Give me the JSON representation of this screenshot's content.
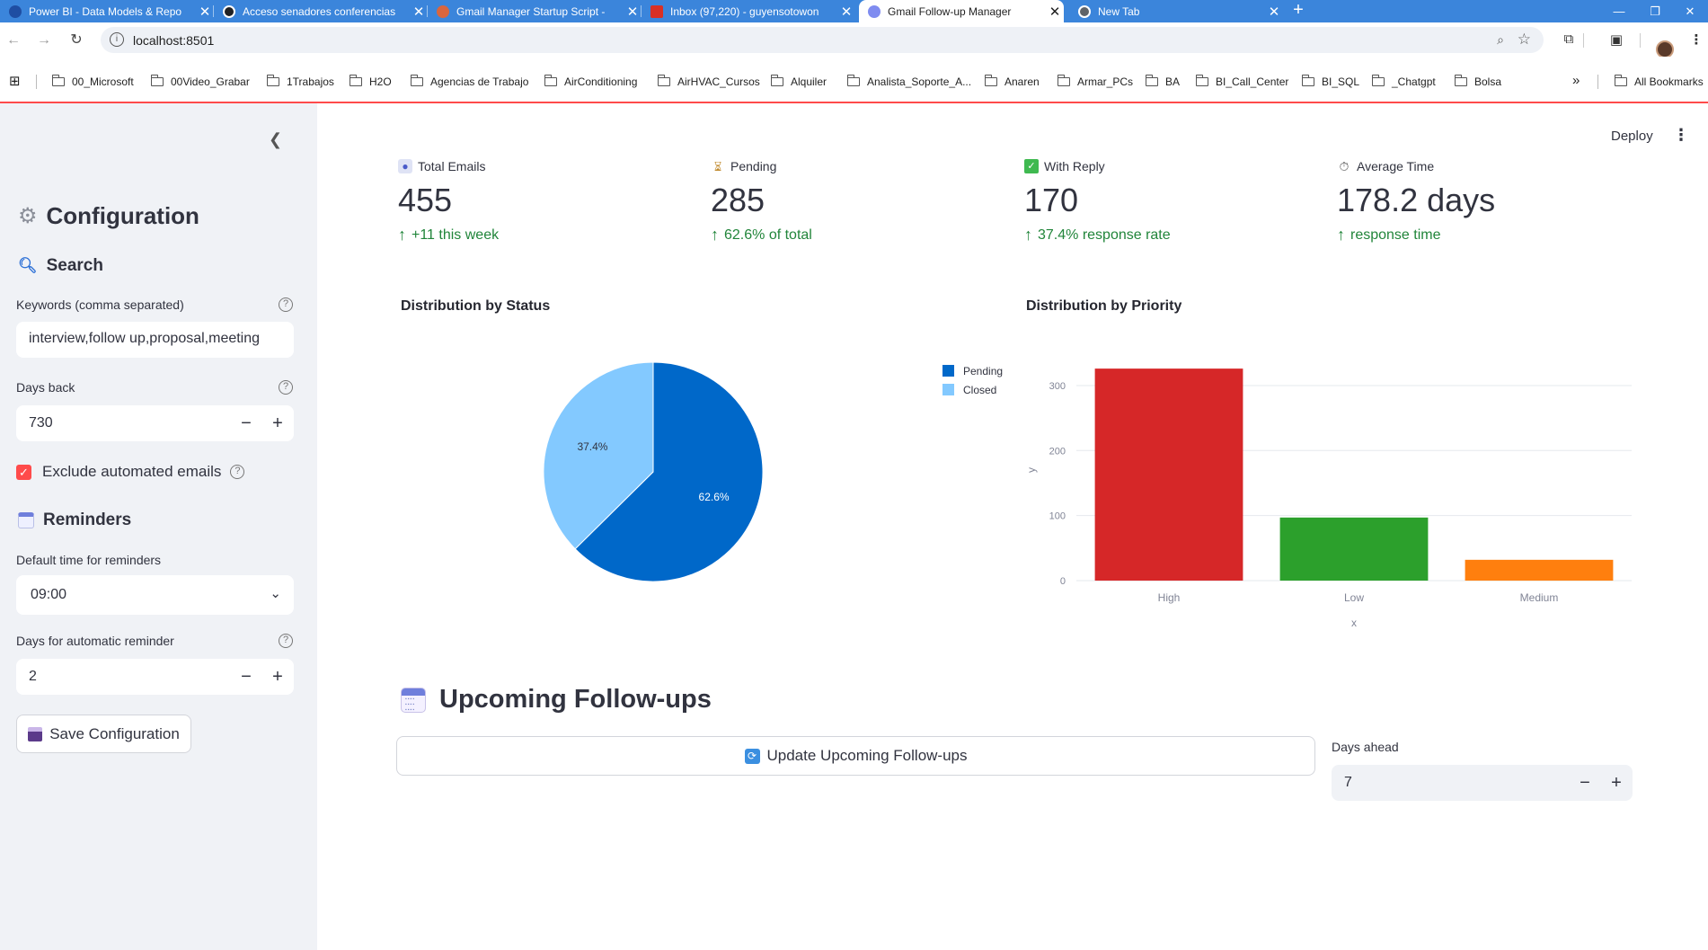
{
  "browser": {
    "tabs": [
      {
        "title": "Power BI - Data Models & Repo",
        "active": false,
        "favicon_color": "#1f4ea3"
      },
      {
        "title": "Acceso senadores conferencias",
        "active": false,
        "favicon_color": "#202124"
      },
      {
        "title": "Gmail Manager Startup Script -",
        "active": false,
        "favicon_color": "#d9663f"
      },
      {
        "title": "Inbox (97,220) - guyensotowon",
        "active": false,
        "favicon_color": "#d93025"
      },
      {
        "title": "Gmail Follow-up Manager",
        "active": true,
        "favicon_color": "#7f8cf0"
      },
      {
        "title": "New Tab",
        "active": false,
        "favicon_color": "#5f6368"
      }
    ],
    "url": "localhost:8501",
    "bookmarks": [
      "00_Microsoft",
      "00Video_Grabar",
      "1Trabajos",
      "H2O",
      "Agencias de Trabajo",
      "AirConditioning",
      "AirHVAC_Cursos",
      "Alquiler",
      "Analista_Soporte_A...",
      "Anaren",
      "Armar_PCs",
      "BA",
      "BI_Call_Center",
      "BI_SQL",
      "_Chatgpt",
      "Bolsa"
    ],
    "all_bookmarks_label": "All Bookmarks"
  },
  "sidebar": {
    "title": "Configuration",
    "search_header": "Search",
    "keywords_label": "Keywords (comma separated)",
    "keywords_value": "interview,follow up,proposal,meeting",
    "days_back_label": "Days back",
    "days_back_value": "730",
    "exclude_label": "Exclude automated emails",
    "exclude_checked": true,
    "reminders_header": "Reminders",
    "default_time_label": "Default time for reminders",
    "default_time_value": "09:00",
    "auto_days_label": "Days for automatic reminder",
    "auto_days_value": "2",
    "save_label": "Save Configuration"
  },
  "header": {
    "deploy_label": "Deploy"
  },
  "metrics": [
    {
      "label": "Total Emails",
      "value": "455",
      "delta": "+11 this week",
      "icon": "email-icon"
    },
    {
      "label": "Pending",
      "value": "285",
      "delta": "62.6% of total",
      "icon": "hourglass-icon"
    },
    {
      "label": "With Reply",
      "value": "170",
      "delta": "37.4% response rate",
      "icon": "check-icon"
    },
    {
      "label": "Average Time",
      "value": "178.2 days",
      "delta": "response time",
      "icon": "stopwatch-icon"
    }
  ],
  "chart_data": [
    {
      "type": "pie",
      "title": "Distribution by Status",
      "labels": [
        "Pending",
        "Closed"
      ],
      "values": [
        62.6,
        37.4
      ],
      "slice_labels": [
        "62.6%",
        "37.4%"
      ],
      "colors": [
        "#0068c9",
        "#83c9ff"
      ],
      "legend": "right"
    },
    {
      "type": "bar",
      "title": "Distribution by Priority",
      "categories": [
        "High",
        "Low",
        "Medium"
      ],
      "values": [
        326,
        97,
        32
      ],
      "colors": [
        "#d62728",
        "#2ca02c",
        "#ff7f0e"
      ],
      "xlabel": "x",
      "ylabel": "y",
      "ylim": [
        0,
        340
      ],
      "yticks": [
        "0",
        "100",
        "200",
        "300"
      ],
      "grid": true
    }
  ],
  "upcoming": {
    "title": "Upcoming Follow-ups",
    "update_label": "Update Upcoming Follow-ups",
    "days_ahead_label": "Days ahead",
    "days_ahead_value": "7"
  }
}
